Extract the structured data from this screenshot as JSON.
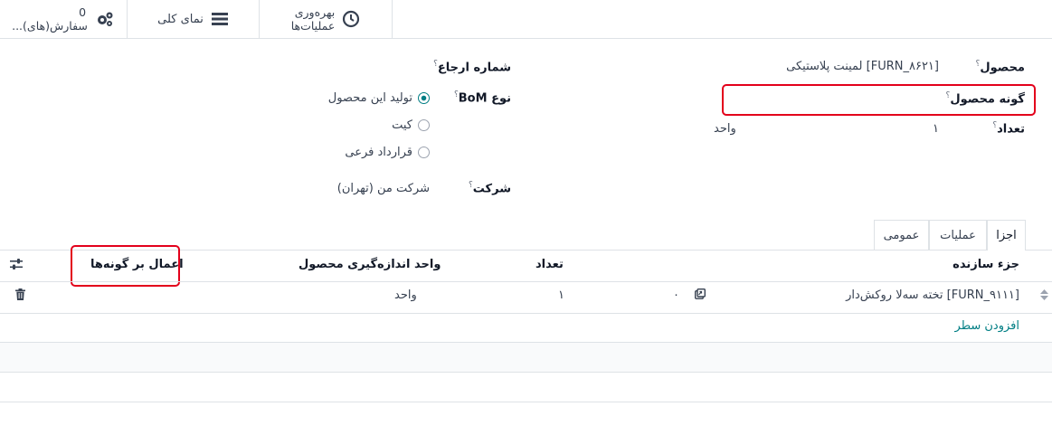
{
  "smart_buttons": {
    "orders": {
      "count": "0",
      "label": "سفارش(های)..."
    },
    "overview": {
      "label": "نمای کلی"
    },
    "efficiency": {
      "line1": "بهره‌وری",
      "line2": "عملیات‌ها"
    }
  },
  "form": {
    "product": {
      "label": "محصول",
      "value": "[FURN_۸۶۲۱] لمینت پلاستیکی"
    },
    "variant": {
      "label": "گونه محصول",
      "value": ""
    },
    "quantity": {
      "label": "تعداد",
      "value": "۱",
      "uom": "واحد"
    },
    "reference": {
      "label": "شماره ارجاع",
      "value": ""
    },
    "bom_type": {
      "label": "نوع BoM",
      "options": [
        {
          "label": "تولید این محصول",
          "selected": true
        },
        {
          "label": "کیت",
          "selected": false
        },
        {
          "label": "قرارداد فرعی",
          "selected": false
        }
      ]
    },
    "company": {
      "label": "شرکت",
      "value": "شرکت من (تهران)"
    },
    "help_mark": "؟"
  },
  "tabs": [
    {
      "label": "اجزا",
      "active": true
    },
    {
      "label": "عملیات",
      "active": false
    },
    {
      "label": "عمومی",
      "active": false
    }
  ],
  "table": {
    "headers": {
      "component": "جزء سازنده",
      "quantity": "تعداد",
      "uom": "واحد اندازه‌گیری محصول",
      "apply_variants": "اعمال بر گونه‌ها"
    },
    "rows": [
      {
        "component": "[FURN_۹۱۱۱] تخته سه‌لا روکش‌دار",
        "forecast": "۰",
        "quantity": "۱",
        "uom": "واحد"
      }
    ],
    "add_line": "افزودن سطر"
  },
  "colors": {
    "accent": "#017e84",
    "highlight": "#e3001b",
    "border": "#dee2e6"
  }
}
